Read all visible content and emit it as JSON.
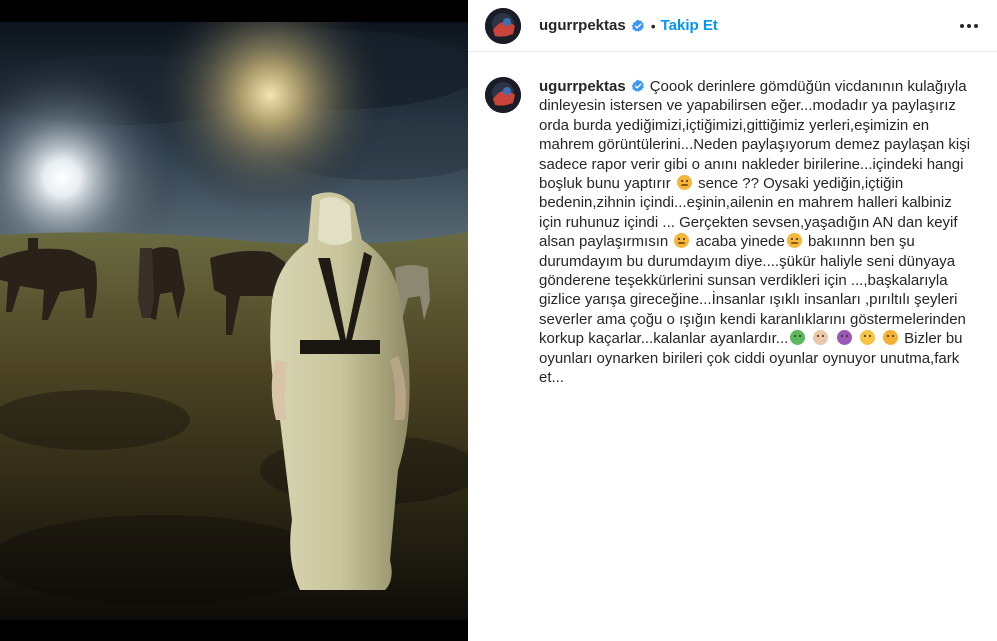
{
  "header": {
    "username": "ugurrpektas",
    "separator": "•",
    "follow_label": "Takip Et"
  },
  "comment": {
    "username": "ugurrpektas",
    "caption_parts": [
      "Çoook derinlere gömdüğün vicdanının kulağıyla dinleyesin istersen ve yapabilirsen eğer...modadır ya paylaşırız orda burda yediğimizi,içtiğimizi,gittiğimiz yerleri,eşimizin en mahrem görüntülerini...Neden paylaşıyorum demez paylaşan kişi sadece rapor verir gibi o anını nakleder birilerine...içindeki hangi boşluk bunu yaptırır",
      "sence ?? Oysaki yediğin,içtiğin bedenin,zihnin içindi...eşinin,ailenin en mahrem halleri kalbiniz için ruhunuz içindi ... Gerçekten sevsen,yaşadığın AN dan keyif alsan paylaşırmısın",
      "acaba yinede",
      "bakıınnn ben şu durumdayım bu durumdayım diye....şükür haliyle seni dünyaya gönderene teşekkürlerini sunsan verdikleri için ...,başkalarıyla gizlice yarışa gireceğine...İnsanlar ışıklı insanları ,pırıltılı şeyleri severler ama çoğu o ışığın kendi karanlıklarını göstermelerinden korkup kaçarlar...kalanlar ayanlardır...",
      "Bizler bu oyunları oynarken birileri çok ciddi oyunlar oynuyor unutma,fark et..."
    ]
  },
  "icons": {
    "verified": "verified-badge-icon",
    "more": "more-options-icon"
  },
  "colors": {
    "accent": "#0095f6",
    "verified": "#3897f0",
    "text": "#262626",
    "divider": "#efefef"
  }
}
